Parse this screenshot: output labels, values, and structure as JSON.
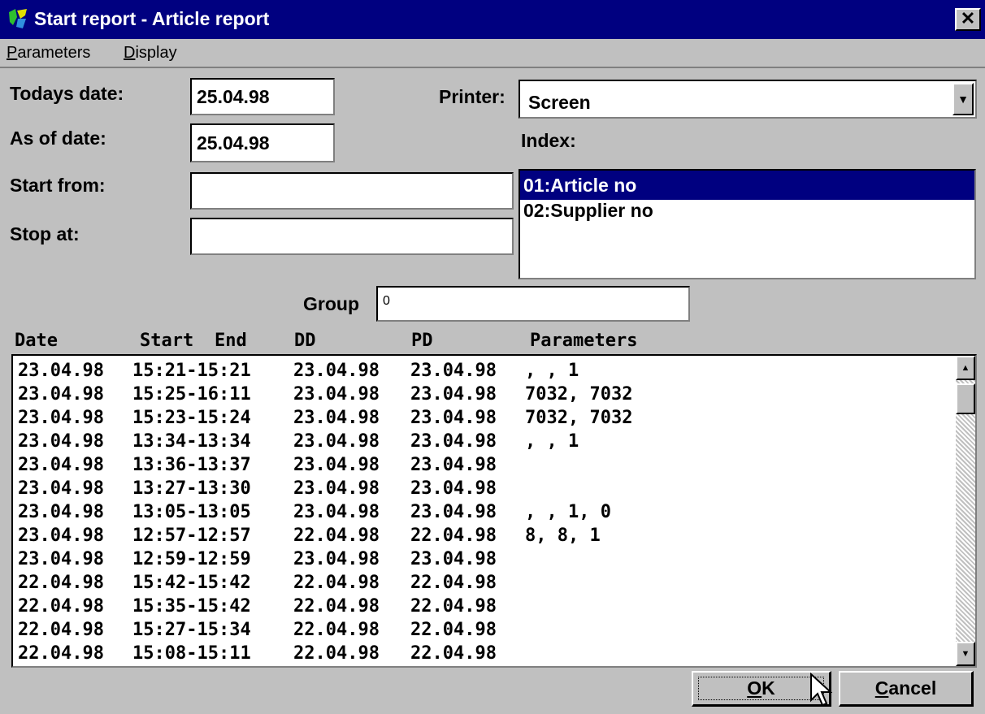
{
  "window": {
    "title": "Start report - Article report",
    "close_glyph": "✕"
  },
  "menu": [
    {
      "label": "Parameters"
    },
    {
      "label": "Display"
    }
  ],
  "form": {
    "todays_date_label": "Todays date:",
    "todays_date_value": "25.04.98",
    "as_of_date_label": "As of date:",
    "as_of_date_value": "25.04.98",
    "start_from_label": "Start from:",
    "start_from_value": "",
    "stop_at_label": "Stop at:",
    "stop_at_value": "",
    "printer_label": "Printer:",
    "printer_value": "Screen",
    "index_label": "Index:",
    "index_items": [
      "01:Article no",
      "02:Supplier no"
    ],
    "index_selected": "01:Article no",
    "group_label": "Group",
    "group_value": "0"
  },
  "history": {
    "columns": [
      "Date",
      "Start",
      "End",
      "DD",
      "PD",
      "Parameters"
    ],
    "rows": [
      {
        "date": "23.04.98",
        "time": "15:21-15:21",
        "dd": "23.04.98",
        "pd": "23.04.98",
        "params": ", , 1"
      },
      {
        "date": "23.04.98",
        "time": "15:25-16:11",
        "dd": "23.04.98",
        "pd": "23.04.98",
        "params": "7032, 7032"
      },
      {
        "date": "23.04.98",
        "time": "15:23-15:24",
        "dd": "23.04.98",
        "pd": "23.04.98",
        "params": "7032, 7032"
      },
      {
        "date": "23.04.98",
        "time": "13:34-13:34",
        "dd": "23.04.98",
        "pd": "23.04.98",
        "params": ", , 1"
      },
      {
        "date": "23.04.98",
        "time": "13:36-13:37",
        "dd": "23.04.98",
        "pd": "23.04.98",
        "params": ""
      },
      {
        "date": "23.04.98",
        "time": "13:27-13:30",
        "dd": "23.04.98",
        "pd": "23.04.98",
        "params": ""
      },
      {
        "date": "23.04.98",
        "time": "13:05-13:05",
        "dd": "23.04.98",
        "pd": "23.04.98",
        "params": ", , 1, 0"
      },
      {
        "date": "23.04.98",
        "time": "12:57-12:57",
        "dd": "22.04.98",
        "pd": "22.04.98",
        "params": "8, 8, 1"
      },
      {
        "date": "23.04.98",
        "time": "12:59-12:59",
        "dd": "23.04.98",
        "pd": "23.04.98",
        "params": ""
      },
      {
        "date": "22.04.98",
        "time": "15:42-15:42",
        "dd": "22.04.98",
        "pd": "22.04.98",
        "params": ""
      },
      {
        "date": "22.04.98",
        "time": "15:35-15:42",
        "dd": "22.04.98",
        "pd": "22.04.98",
        "params": ""
      },
      {
        "date": "22.04.98",
        "time": "15:27-15:34",
        "dd": "22.04.98",
        "pd": "22.04.98",
        "params": ""
      },
      {
        "date": "22.04.98",
        "time": "15:08-15:11",
        "dd": "22.04.98",
        "pd": "22.04.98",
        "params": ""
      }
    ]
  },
  "buttons": {
    "ok": "OK",
    "cancel": "Cancel"
  },
  "colors": {
    "titlebar": "#000080",
    "face": "#c0c0c0",
    "selection": "#000080"
  },
  "icons": [
    "app-icon",
    "close-icon",
    "dropdown-arrow-icon",
    "scroll-up-icon",
    "scroll-down-icon",
    "mouse-cursor-icon"
  ]
}
